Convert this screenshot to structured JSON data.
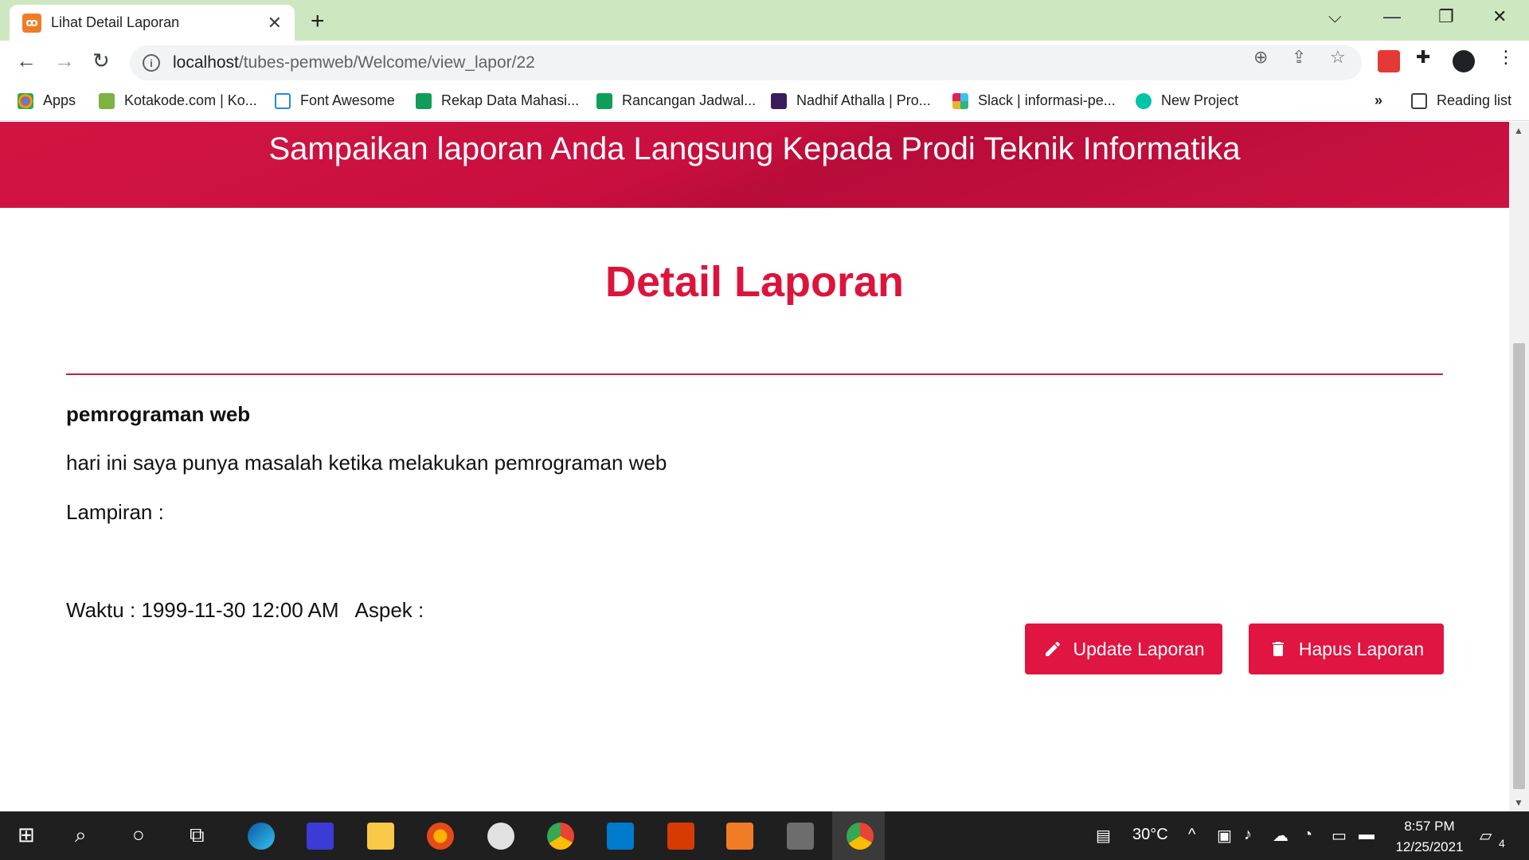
{
  "browser": {
    "tab_title": "Lihat Detail Laporan",
    "url_host": "localhost",
    "url_path": "/tubes-pemweb/Welcome/view_lapor/22",
    "bookmarks": [
      "Apps",
      "Kotakode.com | Ko...",
      "Font Awesome",
      "Rekap Data Mahasi...",
      "Rancangan Jadwal...",
      "Nadhif Athalla | Pro...",
      "Slack | informasi-pe...",
      "New Project"
    ],
    "reading_list": "Reading list",
    "more_bookmarks": "»"
  },
  "page": {
    "banner": "Sampaikan laporan Anda Langsung Kepada Prodi Teknik Informatika",
    "title": "Detail Laporan",
    "subject": "pemrograman web",
    "body": "hari ini saya punya masalah ketika melakukan pemrograman web",
    "attachment_label": "Lampiran :",
    "time_label": "Waktu : 1999-11-30 12:00 AM",
    "aspect_label": "Aspek :",
    "update_button": "Update Laporan",
    "delete_button": "Hapus Laporan"
  },
  "taskbar": {
    "weather": "30°C",
    "time": "8:57 PM",
    "date": "12/25/2021",
    "notifications": "4"
  },
  "colors": {
    "accent": "#dc143c",
    "banner": "#c90f3f",
    "tabstrip": "#cde8c0"
  }
}
